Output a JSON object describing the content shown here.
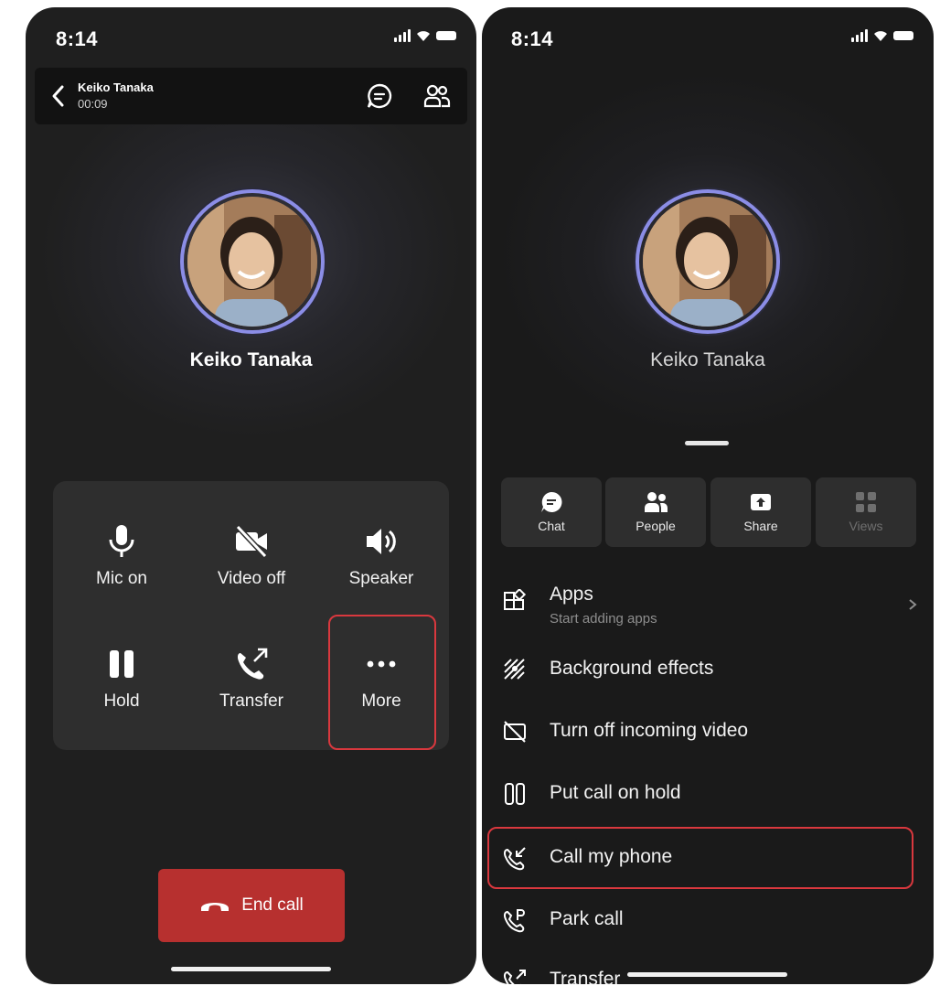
{
  "left": {
    "status": {
      "time": "8:14"
    },
    "header": {
      "caller_name": "Keiko Tanaka",
      "duration": "00:09"
    },
    "caller": {
      "name": "Keiko Tanaka"
    },
    "controls": [
      {
        "label": "Mic on",
        "icon": "mic-icon"
      },
      {
        "label": "Video off",
        "icon": "video-off-icon"
      },
      {
        "label": "Speaker",
        "icon": "speaker-icon"
      },
      {
        "label": "Hold",
        "icon": "pause-icon"
      },
      {
        "label": "Transfer",
        "icon": "transfer-icon"
      },
      {
        "label": "More",
        "icon": "more-icon"
      }
    ],
    "end_call": {
      "label": "End call",
      "color": "#b7302f"
    }
  },
  "right": {
    "status": {
      "time": "8:14"
    },
    "caller": {
      "name": "Keiko Tanaka"
    },
    "tiles": [
      {
        "label": "Chat",
        "icon": "chat-icon"
      },
      {
        "label": "People",
        "icon": "people-icon"
      },
      {
        "label": "Share",
        "icon": "share-icon"
      },
      {
        "label": "Views",
        "icon": "views-icon"
      }
    ],
    "menu": [
      {
        "label": "Apps",
        "sub": "Start adding apps",
        "icon": "apps-icon"
      },
      {
        "label": "Background effects",
        "icon": "background-effects-icon"
      },
      {
        "label": "Turn off incoming video",
        "icon": "video-off-icon"
      },
      {
        "label": "Put call on hold",
        "icon": "hold-icon"
      },
      {
        "label": "Call my phone",
        "icon": "call-my-phone-icon"
      },
      {
        "label": "Park call",
        "icon": "park-call-icon"
      },
      {
        "label": "Transfer",
        "icon": "transfer-icon"
      }
    ]
  },
  "colors": {
    "highlight": "#d9383e",
    "avatar_ring": "#8b8de6",
    "panel": "#2e2e2e"
  }
}
